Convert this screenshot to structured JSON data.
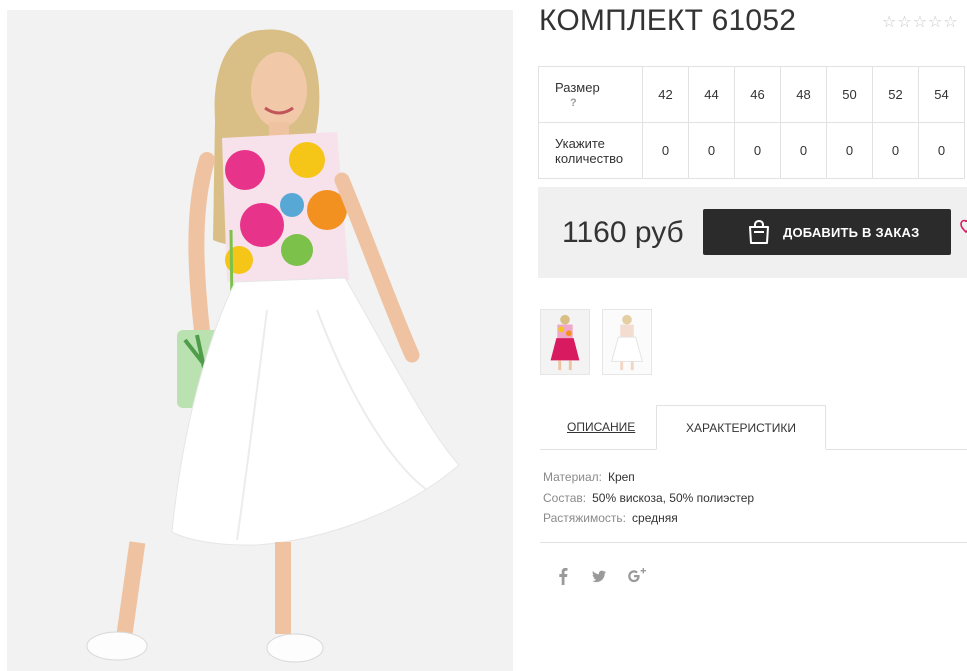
{
  "product": {
    "title": "КОМПЛЕКТ 61052",
    "rating_stars": "☆☆☆☆☆"
  },
  "size_table": {
    "size_label": "Размер",
    "help_mark": "?",
    "qty_label_line1": "Укажите",
    "qty_label_line2": "количество",
    "sizes": [
      "42",
      "44",
      "46",
      "48",
      "50",
      "52",
      "54"
    ],
    "quantities": [
      "0",
      "0",
      "0",
      "0",
      "0",
      "0",
      "0"
    ]
  },
  "purchase": {
    "price": "1160 руб",
    "add_button": "ДОБАВИТЬ В ЗАКАЗ"
  },
  "tabs": {
    "description": "ОПИСАНИЕ",
    "characteristics": "ХАРАКТЕРИСТИКИ"
  },
  "characteristics": [
    {
      "key": "Материал:",
      "value": "Креп"
    },
    {
      "key": "Состав:",
      "value": "50% вискоза, 50% полиэстер"
    },
    {
      "key": "Растяжимость:",
      "value": "средняя"
    }
  ],
  "social": {
    "facebook": "facebook-icon",
    "twitter": "twitter-icon",
    "googleplus": "google-plus-icon"
  },
  "colors": {
    "button_bg": "#2b2b2b",
    "price_bar_bg": "#f0f0f0",
    "accent_pink": "#d81b60"
  }
}
